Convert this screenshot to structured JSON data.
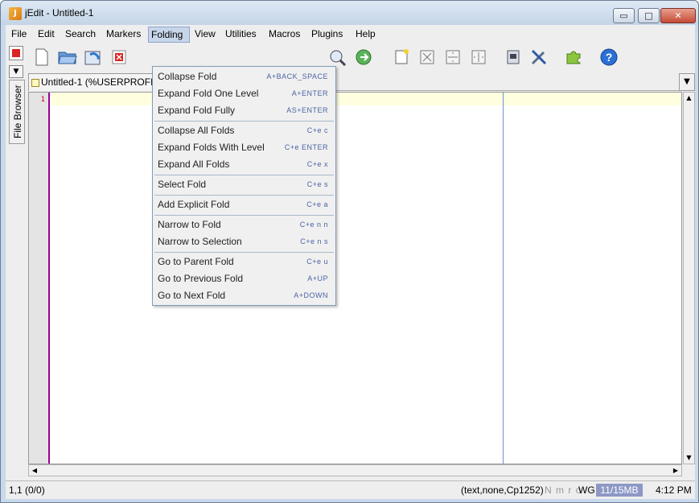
{
  "window": {
    "title": "jEdit - Untitled-1",
    "app_icon_glyph": "J",
    "minimize_glyph": "▭",
    "maximize_glyph": "□",
    "close_glyph": "✕"
  },
  "menubar": {
    "items": [
      {
        "label": "File"
      },
      {
        "label": "Edit"
      },
      {
        "label": "Search"
      },
      {
        "label": "Markers"
      },
      {
        "label": "Folding"
      },
      {
        "label": "View"
      },
      {
        "label": "Utilities"
      },
      {
        "label": "Macros"
      },
      {
        "label": "Plugins"
      },
      {
        "label": "Help"
      }
    ],
    "open_menu": "Folding"
  },
  "toolbar": {
    "icons": [
      "new-file-icon",
      "open-file-icon",
      "reload-icon",
      "close-file-icon",
      "find-icon",
      "find-next-icon",
      "new-view-icon",
      "unsplit-icon",
      "split-horizontal-icon",
      "split-vertical-icon",
      "options-icon",
      "tools-icon",
      "plugin-manager-icon",
      "help-icon"
    ]
  },
  "side_panel": {
    "dock_tab_label": "File Browser",
    "arrow_glyph": "▼"
  },
  "buffer": {
    "tab_label": "Untitled-1 (%USERPROFILE%)",
    "dropdown_glyph": "▼",
    "line_number": "1"
  },
  "scrollbars": {
    "up_glyph": "▲",
    "down_glyph": "▼",
    "left_glyph": "◀",
    "right_glyph": "▶"
  },
  "statusbar": {
    "caret": "1,1 (0/0)",
    "mode": "(text,none,Cp1252)",
    "flags": "N m r o",
    "wg": "WG",
    "memory": "11/15MB",
    "time": "4:12 PM"
  },
  "folding_menu": {
    "groups": [
      [
        {
          "label": "Collapse Fold",
          "accel": "A+BACK_SPACE"
        },
        {
          "label": "Expand Fold One Level",
          "accel": "A+ENTER"
        },
        {
          "label": "Expand Fold Fully",
          "accel": "AS+ENTER"
        }
      ],
      [
        {
          "label": "Collapse All Folds",
          "accel": "C+e c"
        },
        {
          "label": "Expand Folds With Level",
          "accel": "C+e ENTER"
        },
        {
          "label": "Expand All Folds",
          "accel": "C+e x"
        }
      ],
      [
        {
          "label": "Select Fold",
          "accel": "C+e s"
        }
      ],
      [
        {
          "label": "Add Explicit Fold",
          "accel": "C+e a"
        }
      ],
      [
        {
          "label": "Narrow to Fold",
          "accel": "C+e n n"
        },
        {
          "label": "Narrow to Selection",
          "accel": "C+e n s"
        }
      ],
      [
        {
          "label": "Go to Parent Fold",
          "accel": "C+e u"
        },
        {
          "label": "Go to Previous Fold",
          "accel": "A+UP"
        },
        {
          "label": "Go to Next Fold",
          "accel": "A+DOWN"
        }
      ]
    ]
  },
  "colors": {
    "gutter_border": "#9b0091",
    "current_line": "#ffffe0",
    "wrap_guide": "#6f8fcf",
    "memory_bar": "#8d98c5",
    "accelerator_text": "#4a63a5"
  }
}
